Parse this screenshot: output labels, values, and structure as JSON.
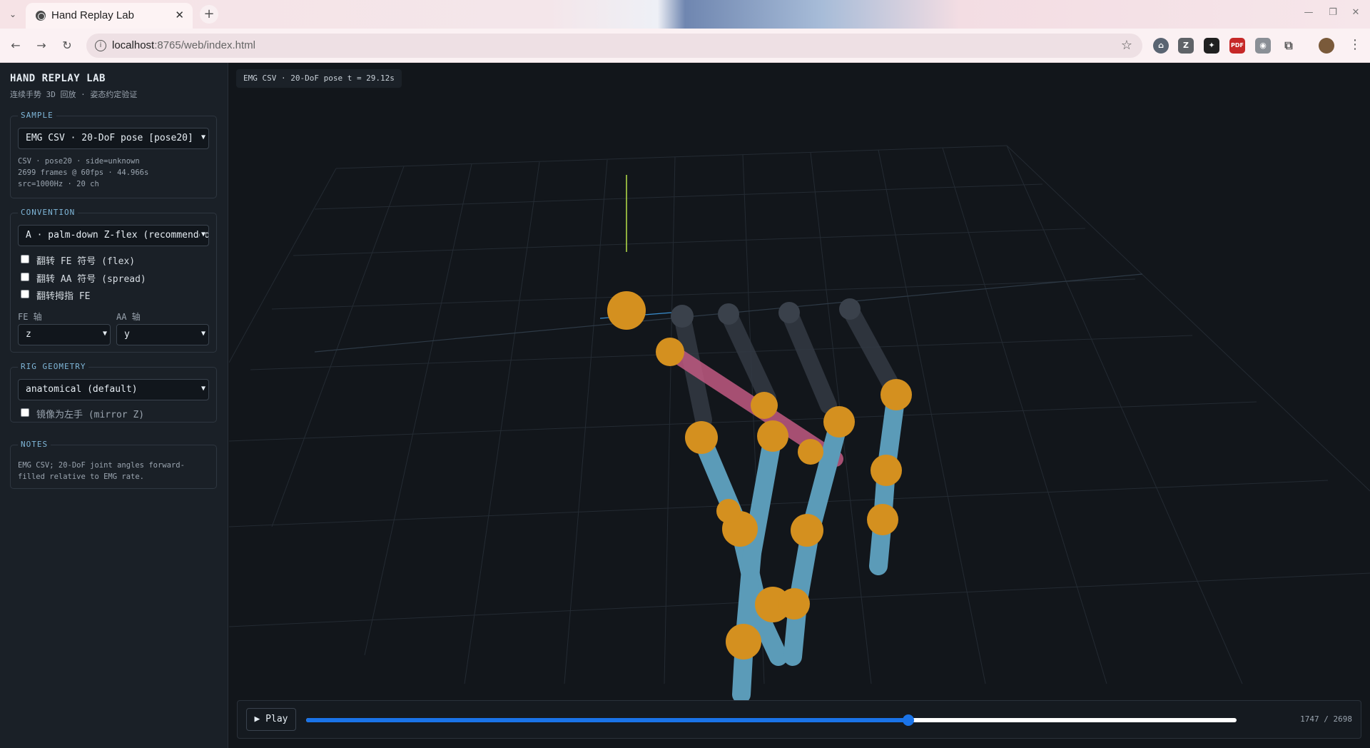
{
  "browser": {
    "tab_title": "Hand Replay Lab",
    "url_host": "localhost",
    "url_path": ":8765/web/index.html",
    "new_tab_glyph": "+",
    "close_glyph": "✕"
  },
  "sidebar": {
    "title": "HAND REPLAY LAB",
    "subtitle": "连续手势 3D 回放 · 姿态约定验证",
    "sample": {
      "legend": "SAMPLE",
      "selected": "EMG CSV · 20-DoF pose [pose20]",
      "meta": "CSV · pose20 · side=unknown\n2699 frames @ 60fps · 44.966s\nsrc=1000Hz · 20 ch"
    },
    "convention": {
      "legend": "CONVENTION",
      "selected": "A · palm-down Z-flex (recommended)",
      "checkboxes": [
        {
          "label": "翻转 FE 符号 (flex)",
          "checked": false
        },
        {
          "label": "翻转 AA 符号 (spread)",
          "checked": false
        },
        {
          "label": "翻转拇指 FE",
          "checked": false
        }
      ],
      "fe_axis_label": "FE 轴",
      "fe_axis_value": "z",
      "aa_axis_label": "AA 轴",
      "aa_axis_value": "y"
    },
    "rig": {
      "legend": "RIG GEOMETRY",
      "selected": "anatomical (default)",
      "mirror_label": "镜像为左手 (mirror Z)",
      "mirror_checked": false
    },
    "notes": {
      "legend": "NOTES",
      "text": "EMG CSV; 20-DoF joint angles forward-filled relative to EMG rate."
    }
  },
  "viewport": {
    "hud": "EMG CSV · 20-DoF pose t = 29.12s"
  },
  "playback": {
    "play_label": "▶ Play",
    "current_frame": 1747,
    "max_frame": 2698,
    "readout": "1747 / 2698",
    "progress": 0.6475
  },
  "colors": {
    "bone": "#5b9bb8",
    "joint": "#d4901f",
    "palm": "#c05a82",
    "accent": "#1a73e8"
  }
}
